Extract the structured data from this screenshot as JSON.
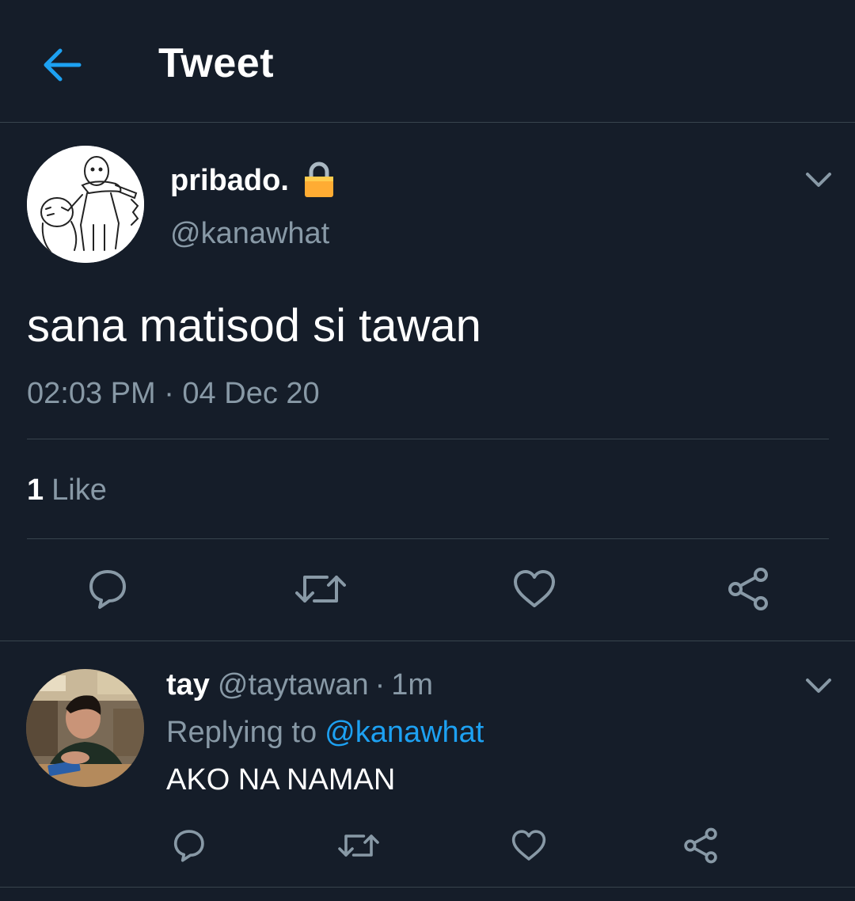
{
  "header": {
    "title": "Tweet",
    "back_icon": "arrow-left-icon",
    "accent": "#1da1f2"
  },
  "tweet": {
    "display_name": "pribado.",
    "handle": "@kanawhat",
    "protected_icon": "lock-icon",
    "text": "sana matisod si tawan",
    "timestamp": "02:03 PM · 04 Dec 20",
    "likes_count": "1",
    "likes_label": "Like",
    "actions": [
      "reply-icon",
      "retweet-icon",
      "like-icon",
      "share-icon"
    ]
  },
  "reply": {
    "display_name": "tay",
    "handle": "@taytawan",
    "separator": "·",
    "time": "1m",
    "replying_prefix": "Replying to",
    "replying_to": "@kanawhat",
    "text": "AKO NA NAMAN",
    "actions": [
      "reply-icon",
      "retweet-icon",
      "like-icon",
      "share-icon"
    ]
  },
  "colors": {
    "background": "#151d29",
    "divider": "#38444d",
    "secondary_text": "#8899a6",
    "accent": "#1da1f2"
  }
}
